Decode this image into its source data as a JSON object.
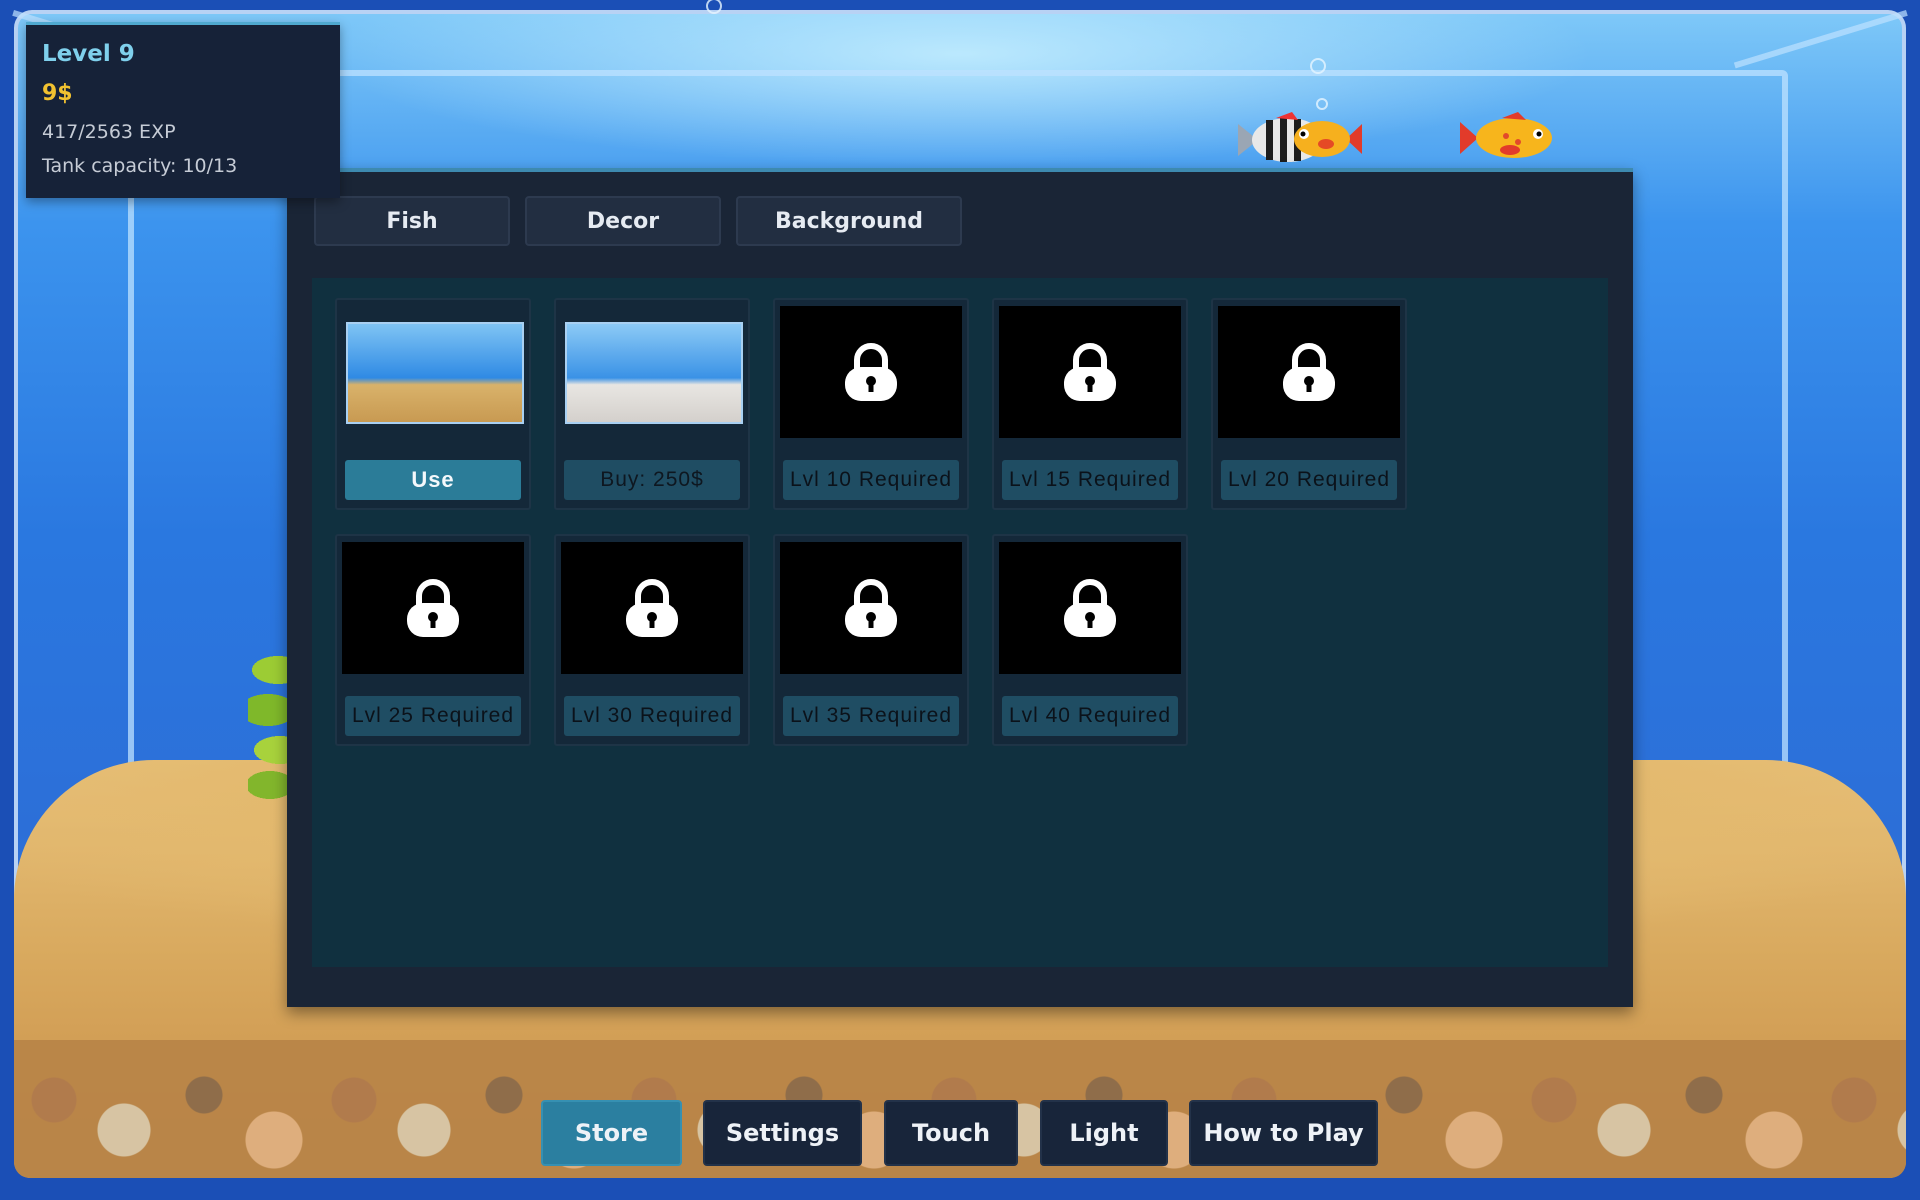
{
  "hud": {
    "level": "Level 9",
    "money": "9$",
    "exp": "417/2563 EXP",
    "capacity": "Tank capacity: 10/13"
  },
  "store": {
    "tabs": [
      {
        "label": "Fish"
      },
      {
        "label": "Decor"
      },
      {
        "label": "Background"
      }
    ],
    "items": [
      {
        "thumb": "sand-tank-background",
        "locked": false,
        "button": "Use"
      },
      {
        "thumb": "white-sand-tank-background",
        "locked": false,
        "button": "Buy: 250$"
      },
      {
        "thumb": "lock-icon",
        "locked": true,
        "button": "Lvl 10 Required"
      },
      {
        "thumb": "lock-icon",
        "locked": true,
        "button": "Lvl 15 Required"
      },
      {
        "thumb": "lock-icon",
        "locked": true,
        "button": "Lvl 20 Required"
      },
      {
        "thumb": "lock-icon",
        "locked": true,
        "button": "Lvl 25 Required"
      },
      {
        "thumb": "lock-icon",
        "locked": true,
        "button": "Lvl 30 Required"
      },
      {
        "thumb": "lock-icon",
        "locked": true,
        "button": "Lvl 35 Required"
      },
      {
        "thumb": "lock-icon",
        "locked": true,
        "button": "Lvl 40 Required"
      }
    ]
  },
  "nav": {
    "store": "Store",
    "settings": "Settings",
    "touch": "Touch",
    "light": "Light",
    "how_to_play": "How to Play"
  },
  "colors": {
    "accent": "#2b7c98",
    "money": "#f2c230",
    "level": "#7fd0ec"
  }
}
